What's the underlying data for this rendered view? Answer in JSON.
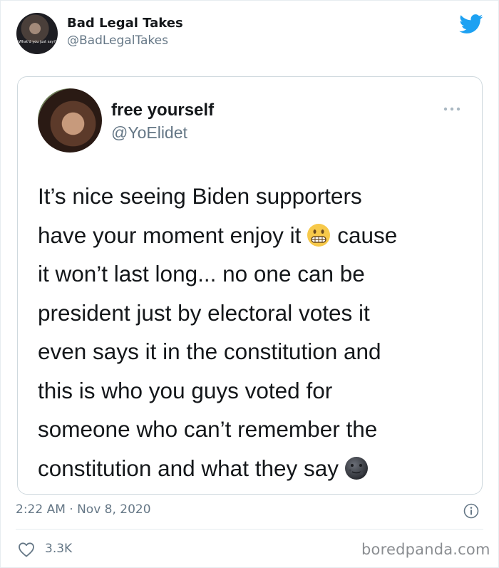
{
  "header": {
    "name": "Bad Legal Takes",
    "handle": "@BadLegalTakes",
    "avatar_caption": "What'd you just say?",
    "logo_icon": "twitter-bird-icon",
    "logo_color": "#1da1f2"
  },
  "quoted": {
    "name": "free yourself",
    "handle": "@YoElidet",
    "lines": [
      "It’s nice seeing Biden supporters",
      "have your moment enjoy it",
      "it won’t last long... no one can be",
      "president just by electoral votes it",
      "even says it in the constitution and",
      "this is who you guys voted for",
      "someone who can’t remember the",
      "constitution and what they say"
    ],
    "line2_tail": "cause",
    "emoji_1": "grimacing-face-emoji",
    "emoji_2": "new-moon-face-emoji",
    "more_icon": "more-dots-icon"
  },
  "footer": {
    "timestamp": "2:22 AM · Nov 8, 2020",
    "likes": "3.3K",
    "like_icon": "heart-icon",
    "info_icon": "info-icon",
    "watermark": "boredpanda.com"
  },
  "colors": {
    "text_primary": "#14171a",
    "text_secondary": "#657786",
    "border": "#cfd9de",
    "divider": "#e6ecf0"
  }
}
